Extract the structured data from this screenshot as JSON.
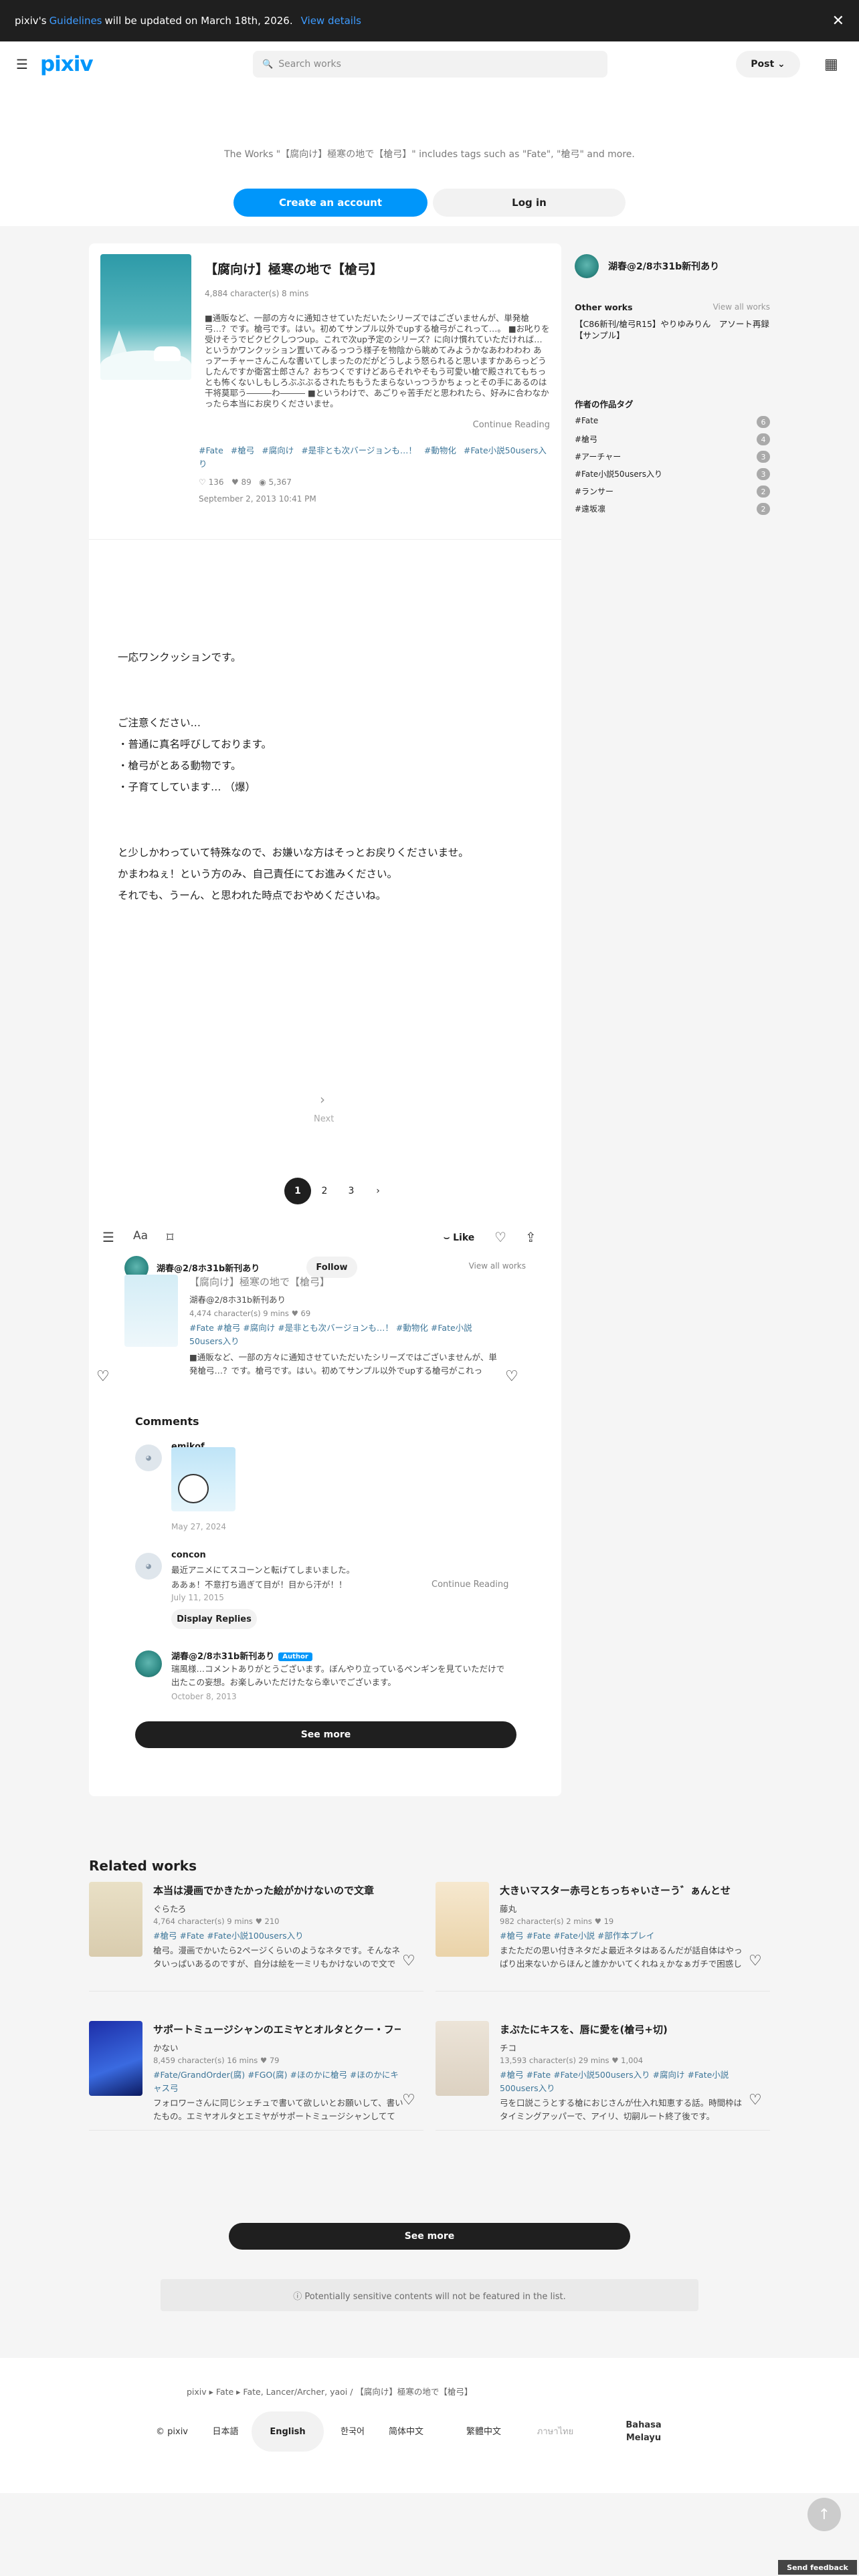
{
  "notice": {
    "pre": "pixiv's",
    "link": "Guidelines",
    "post": "will be updated on March 18th, 2026.",
    "view": "View details",
    "close": "✕"
  },
  "header": {
    "logo": "pixiv",
    "search_placeholder": "Search works",
    "post": "Post ⌄"
  },
  "promo": {
    "text": "The Works \"【腐向け】極寒の地で【槍弓】\" includes tags such as \"Fate\", \"槍弓\" and more.",
    "create": "Create an account",
    "login": "Log in"
  },
  "work": {
    "title": "【腐向け】極寒の地で【槍弓】",
    "meta": "4,884 character(s)  8 mins",
    "description": "■通販など、一部の方々に通知させていただいたシリーズではございませんが、単発槍弓…？です。槍弓です。はい。初めてサンプル以外でupする槍弓がこれって…。 ■お叱りを受けそうでビクビクしつつup。これで次up予定のシリーズ？に向け慣れていただければ…というかワンクッション置いてみるっつう様子を物陰から眺めてみようかなあわわわわ あっアーチャーさんこんな書いてしまったのだがどうしよう怒られると思いますかあらっどうしたんですか衛宮士郎さん？おちつくですけどあらそれやそもう可愛い槍で殿されてもちっとも怖くないしもしろぶぶぶるされたちもうたまらないっつうかちょっとその手にあるのは干将莫耶う―――わ――― ■というわけで、あごりゃ苦手だと思われたら、好みに合わなかったら本当にお戻りくださいませ。",
    "continue": "Continue Reading",
    "tags": [
      "#Fate",
      "#槍弓",
      "#腐向け",
      "#是非とも次バージョンも…！",
      "#動物化",
      "#Fate小説50users入り"
    ],
    "likes": "♡ 136",
    "hearts": "♥ 89",
    "views": "◉ 5,367",
    "date": "September 2, 2013 10:41 PM"
  },
  "body": {
    "l1": "一応ワンクッションです。",
    "l2": "ご注意ください…",
    "l3": "・普通に真名呼びしております。",
    "l4": "・槍弓がとある動物です。",
    "l5": "・子育てしています… （爆）",
    "l6": "と少しかわっていて特殊なので、お嫌いな方はそっとお戻りくださいませ。",
    "l7": "かまわねぇ！という方のみ、自己責任にてお進みください。",
    "l8": "それでも、うーん、と思われた時点でおやめくださいね。"
  },
  "next": {
    "arrow": "›",
    "label": "Next"
  },
  "pagination": {
    "p1": "1",
    "p2": "2",
    "p3": "3",
    "arrow": "›"
  },
  "toolbar": {
    "like": "Like"
  },
  "author": {
    "name": "湖春@2/8ホ31b新刊あり",
    "follow": "Follow",
    "view_all": "View all works"
  },
  "mini": {
    "title": "【腐向け】極寒の地で【槍弓】",
    "author": "湖春@2/8ホ31b新刊あり",
    "meta": "4,474 character(s)  9 mins  ♥ 69",
    "tags": [
      "#Fate",
      "#槍弓",
      "#腐向け",
      "#是非とも次バージョンも…！",
      "#動物化",
      "#Fate小説50users入り"
    ],
    "desc": "■通販など、一部の方々に通知させていただいたシリーズではございませんが、単発槍弓…？です。槍弓です。はい。初めてサンプル以外でupする槍弓がこれって…。 ■お叱りを受けそうでビクビクしつつup。これで次…"
  },
  "comments": {
    "title": "Comments",
    "c1": {
      "name": "emikof",
      "date": "May 27, 2024"
    },
    "c2": {
      "name": "concon",
      "text1": "最近アニメにてスコーンと転げてしまいました。",
      "text2": "ああぁ！不意打ち過ぎて目が！目から汗が！！",
      "date": "July 11, 2015",
      "continue": "Continue Reading",
      "replies": "Display Replies"
    },
    "c3": {
      "name": "湖春@2/8ホ31b新刊あり",
      "badge": "Author",
      "text1": "瑞風様…コメントありがとうございます。ぼんやり立っているペンギンを見ていただけで出たこの妄想。お楽しみいただけたなら幸いでございます。",
      "date": "October 8, 2013"
    },
    "see_more": "See more"
  },
  "side": {
    "author": "湖春@2/8ホ31b新刊あり",
    "other_works": "Other works",
    "view_all": "View all works",
    "work": "【C86新刊/槍弓R15】やりゆみりん　アソート再録【サンプル】",
    "tags_h": "作者の作品タグ",
    "tags": [
      {
        "name": "#Fate",
        "n": "6"
      },
      {
        "name": "#槍弓",
        "n": "4"
      },
      {
        "name": "#アーチャー",
        "n": "3"
      },
      {
        "name": "#Fate小説50users入り",
        "n": "3"
      },
      {
        "name": "#ランサー",
        "n": "2"
      },
      {
        "name": "#遠坂凛",
        "n": "2"
      }
    ]
  },
  "related": {
    "title": "Related works",
    "cards": [
      {
        "title": "本当は漫画でかきたかった絵がかけないので文章",
        "author": "ぐらたろ",
        "meta": "4,764 character(s)  9 mins  ♥ 210",
        "tags": "#槍弓  #Fate  #Fate小説100users入り",
        "desc": "槍弓。漫画でかいたら2ページくらいのようなネタです。そんなネタいっぱいあるのですが、自分は絵を一ミリもかけないので文で書くしかありません。絵のかける方がうら…"
      },
      {
        "title": "大きいマスター赤弓とちっちゃいさーう゛ぁんとせ",
        "author": "藤丸",
        "meta": "982 character(s)  2 mins  ♥ 19",
        "tags": "#槍弓  #Fate  #Fate小説  #部作本プレイ",
        "desc": "またただの思い付きネタだよ最近ネタはあるんだが話自体はやっぱり出来ないからほんと誰かかいてくれねぇかなぁガチで困惑しないんだCCCでアルター エゴとの…"
      },
      {
        "title": "サポートミュージシャンのエミヤとオルタとクー・フーリン",
        "author": "かない",
        "meta": "8,459 character(s)  16 mins  ♥ 79",
        "tags": "#Fate/GrandOrder(腐)  #FGO(腐)  #ほのかに槍弓  #ほのかにキャス弓",
        "desc": "フォロワーさんに同じシェチュで書いて欲しいとお願いして、書いたもの。エミヤオルタとエミヤがサポートミュージシャンしててな槍弓だったはずなのにそこにや…"
      },
      {
        "title": "まぶたにキスを、唇に愛を(槍弓+切)",
        "author": "チコ",
        "meta": "13,593 character(s)  29 mins  ♥ 1,004",
        "tags": "#槍弓  #Fate  #Fate小説500users入り  #腐向け  #Fate小説500users入り",
        "desc": "弓を口説こうとする槍におじさんが仕入れ知恵する話。時間枠はタイミングアッパーで、アイリ、切嗣ルート終了後です。"
      }
    ],
    "see_more": "See more"
  },
  "sensitive": "ⓘ  Potentially sensitive contents will not be featured in the list.",
  "footer": {
    "crumb": "pixiv  ▸  Fate  ▸  Fate, Lancer/Archer, yaoi  /  【腐向け】極寒の地で【槍弓】",
    "copy": "© pixiv",
    "langs": [
      "日本語",
      "English",
      "한국어",
      "简体中文",
      "繁體中文",
      "ภาษาไทย",
      "Bahasa Melayu"
    ]
  },
  "feedback": "Send feedback"
}
